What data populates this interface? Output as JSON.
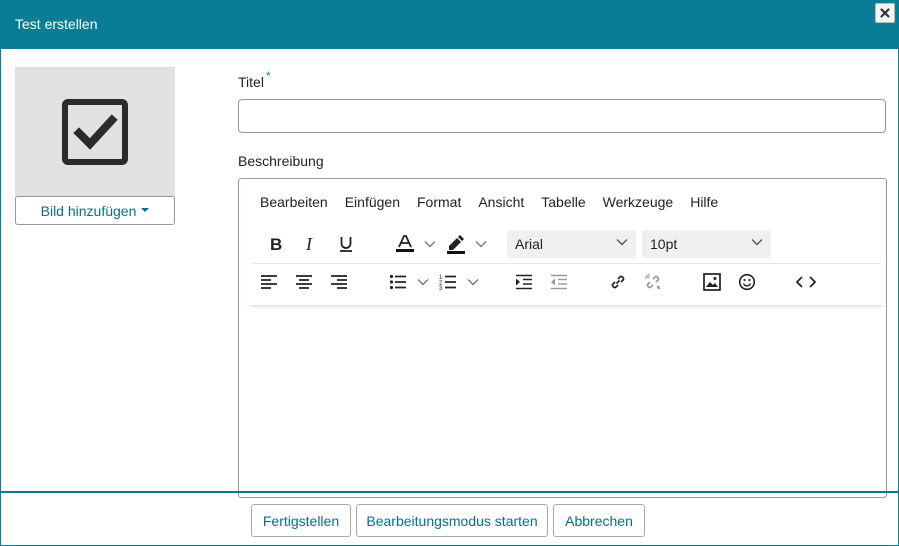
{
  "dialog": {
    "title": "Test erstellen",
    "close_icon": "close-icon"
  },
  "image_panel": {
    "icon": "checkbox-checked-icon",
    "add_image_label": "Bild hinzufügen"
  },
  "form": {
    "title_label": "Titel",
    "required_marker": "*",
    "title_value": "",
    "description_label": "Beschreibung"
  },
  "editor": {
    "menu": [
      "Bearbeiten",
      "Einfügen",
      "Format",
      "Ansicht",
      "Tabelle",
      "Werkzeuge",
      "Hilfe"
    ],
    "font_family": "Arial",
    "font_size": "10pt",
    "toolbar_row1_icons": [
      "bold-icon",
      "italic-icon",
      "underline-icon",
      "text-color-icon",
      "highlight-color-icon"
    ],
    "toolbar_row2_icons": [
      "align-left-icon",
      "align-center-icon",
      "align-right-icon",
      "bullet-list-icon",
      "numbered-list-icon",
      "indent-icon",
      "outdent-icon",
      "link-icon",
      "unlink-icon",
      "image-icon",
      "emoji-icon",
      "source-code-icon"
    ]
  },
  "footer": {
    "finish_label": "Fertigstellen",
    "edit_mode_label": "Bearbeitungsmodus starten",
    "cancel_label": "Abbrechen"
  },
  "colors": {
    "header": "#0a7d96",
    "accent_text": "#0a6e8a",
    "image_placeholder": "#e1e1e1"
  }
}
